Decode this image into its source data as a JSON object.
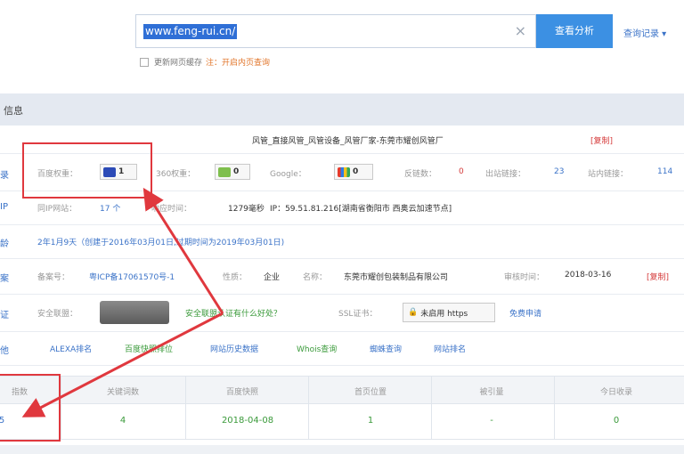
{
  "search": {
    "value": "www.feng-rui.cn/",
    "clear_icon": "close-icon",
    "button_label": "查看分析",
    "history_label": "查询记录 ▾"
  },
  "refresh": {
    "label": "更新网页缓存",
    "note": "注：开启内页查询"
  },
  "section": {
    "title": "信息"
  },
  "site_title": {
    "text": "风管_直接风管_风管设备_风管厂家-东莞市耀创风管厂",
    "report": "[复制]"
  },
  "weights": {
    "row_label": "录",
    "baidu": {
      "label": "百度权重：",
      "value": "1"
    },
    "s360": {
      "label": "360权重：",
      "value": "0"
    },
    "google": {
      "label": "Google：",
      "value": "0"
    },
    "reverse": {
      "label": "反链数：",
      "value": "0"
    },
    "outbound": {
      "label": "出站链接：",
      "value": "23"
    },
    "inbound": {
      "label": "站内链接：",
      "value": "114"
    }
  },
  "ip": {
    "row_label": "IP",
    "same_ip_label": "同IP网站：",
    "same_ip_value": "17 个",
    "speed_label": "响应时间：",
    "speed_value": "1279毫秒",
    "ip_text": "IP：59.51.81.216[湖南省衡阳市 西奥云加速节点]"
  },
  "domain_age": {
    "row_label": "龄",
    "text": "2年1月9天（创建于2016年03月01日,过期时间为2019年03月01日)"
  },
  "icp": {
    "row_label": "案",
    "record_label": "备案号：",
    "record_value": "粤ICP备17061570号-1",
    "nature_label": "性质：",
    "nature_value": "企业",
    "name_label": "名称：",
    "name_value": "东莞市耀创包装制品有限公司",
    "date_label": "审核时间：",
    "date_value": "2018-03-16",
    "report": "[复制]"
  },
  "security": {
    "row_label": "证",
    "safe_label": "安全联盟：",
    "trust_link": "安全联盟认证有什么好处？",
    "ssl_label": "SSL证书：",
    "ssl_badge": "未启用 https",
    "apply": "免费申请"
  },
  "tools": {
    "row_label": "他",
    "links": [
      "ALEXA排名",
      "百度快照排位",
      "网站历史数据",
      "Whois查询",
      "蜘蛛查询",
      "网站排名"
    ]
  },
  "rank_table": {
    "headers": [
      "指数",
      "关键词数",
      "百度快照",
      "首页位置",
      "被引量",
      "今日收录"
    ],
    "row": [
      "5",
      "4",
      "2018-04-08",
      "1",
      "-",
      "0"
    ]
  },
  "colors": {
    "accent": "#3c90e3",
    "highlight": "#e0383e",
    "link": "#3b73c8"
  }
}
